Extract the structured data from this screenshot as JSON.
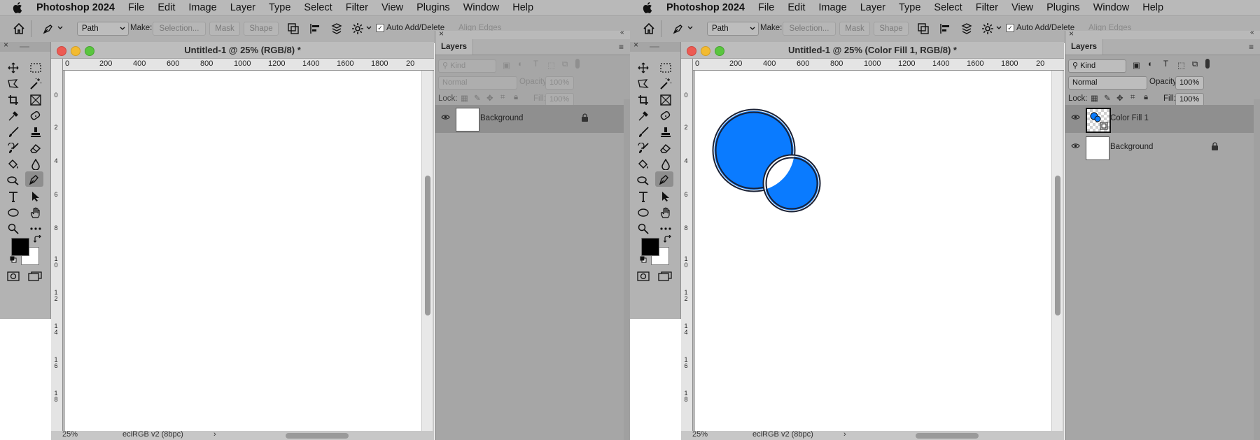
{
  "left": {
    "menubar": {
      "app_name": "Photoshop 2024",
      "items": [
        "File",
        "Edit",
        "Image",
        "Layer",
        "Type",
        "Select",
        "Filter",
        "View",
        "Plugins",
        "Window",
        "Help"
      ]
    },
    "options": {
      "mode": "Path",
      "make_label": "Make:",
      "selection_btn": "Selection...",
      "mask_btn": "Mask",
      "shape_btn": "Shape",
      "auto_add_delete": "Auto Add/Delete",
      "align_edges": "Align Edges"
    },
    "document": {
      "title": "Untitled-1 @ 25% (RGB/8) *",
      "zoom": "25%",
      "profile": "eciRGB v2 (8bpc)"
    },
    "ruler": {
      "h": [
        "0",
        "200",
        "400",
        "600",
        "800",
        "1000",
        "1200",
        "1400",
        "1600",
        "1800",
        "20"
      ],
      "v": [
        "0",
        "2",
        "4",
        "6",
        "8",
        "10",
        "12",
        "14",
        "16",
        "18"
      ]
    },
    "layers_panel": {
      "tab": "Layers",
      "kind": "Kind",
      "blend_mode": "Normal",
      "opacity_label": "Opacity:",
      "opacity_value": "100%",
      "lock_label": "Lock:",
      "fill_label": "Fill:",
      "fill_value": "100%",
      "layers": [
        {
          "name": "Background",
          "locked": true
        }
      ]
    }
  },
  "right": {
    "menubar": {
      "app_name": "Photoshop 2024",
      "items": [
        "File",
        "Edit",
        "Image",
        "Layer",
        "Type",
        "Select",
        "Filter",
        "View",
        "Plugins",
        "Window",
        "Help"
      ]
    },
    "options": {
      "mode": "Path",
      "make_label": "Make:",
      "selection_btn": "Selection...",
      "mask_btn": "Mask",
      "shape_btn": "Shape",
      "auto_add_delete": "Auto Add/Delete",
      "align_edges": "Align Edges"
    },
    "document": {
      "title": "Untitled-1 @ 25% (Color Fill 1, RGB/8) *",
      "zoom": "25%",
      "profile": "eciRGB v2 (8bpc)"
    },
    "ruler": {
      "h": [
        "0",
        "200",
        "400",
        "600",
        "800",
        "1000",
        "1200",
        "1400",
        "1600",
        "1800",
        "20"
      ],
      "v": [
        "0",
        "2",
        "4",
        "6",
        "8",
        "10",
        "12",
        "14",
        "16",
        "18"
      ]
    },
    "canvas_shape": {
      "fill": "#0a7bff",
      "stroke": "#1a2135"
    },
    "layers_panel": {
      "tab": "Layers",
      "kind": "Kind",
      "blend_mode": "Normal",
      "opacity_label": "Opacity:",
      "opacity_value": "100%",
      "lock_label": "Lock:",
      "fill_label": "Fill:",
      "fill_value": "100%",
      "layers": [
        {
          "name": "Color Fill 1",
          "locked": false
        },
        {
          "name": "Background",
          "locked": true
        }
      ]
    }
  }
}
